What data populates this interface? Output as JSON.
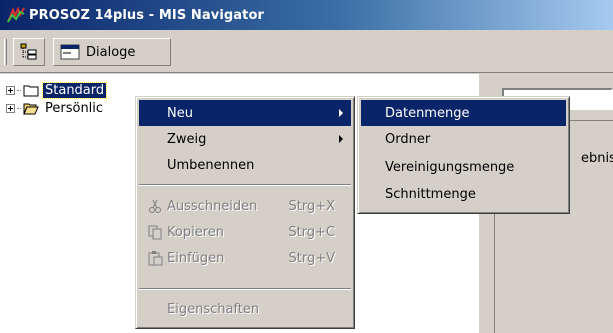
{
  "window": {
    "title": "PROSOZ 14plus - MIS Navigator"
  },
  "toolbar": {
    "dialoge_label": "Dialoge"
  },
  "tree": {
    "items": [
      {
        "label": "Standard"
      },
      {
        "label": "Persönlic"
      }
    ]
  },
  "right_pane": {
    "partial_text": "ebnis"
  },
  "context_menu": {
    "items": [
      {
        "label": "Neu"
      },
      {
        "label": "Zweig"
      },
      {
        "label": "Umbenennen"
      },
      {
        "label": "Ausschneiden",
        "shortcut": "Strg+X"
      },
      {
        "label": "Kopieren",
        "shortcut": "Strg+C"
      },
      {
        "label": "Einfügen",
        "shortcut": "Strg+V"
      },
      {
        "label": "Eigenschaften"
      }
    ]
  },
  "submenu": {
    "items": [
      {
        "label": "Datenmenge"
      },
      {
        "label": "Ordner"
      },
      {
        "label": "Vereinigungsmenge"
      },
      {
        "label": "Schnittmenge"
      }
    ]
  },
  "colors": {
    "title_gradient_start": "#0a246a",
    "highlight": "#0a246a",
    "face": "#d4d0c8"
  }
}
